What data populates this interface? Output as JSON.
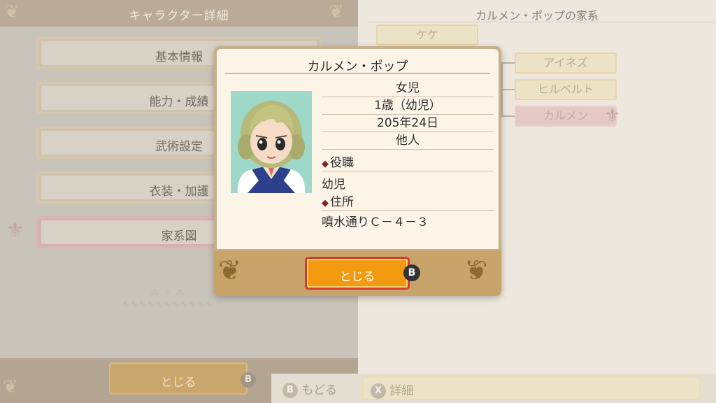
{
  "left_panel": {
    "title": "キャラクター詳細",
    "menu": [
      {
        "label": "基本情報"
      },
      {
        "label": "能力・成績"
      },
      {
        "label": "武術設定"
      },
      {
        "label": "衣装・加護"
      },
      {
        "label": "家系図"
      }
    ],
    "selected_index": 4,
    "close_button": {
      "label": "とじる",
      "hint": "B"
    }
  },
  "right_panel": {
    "title": "カルメン・ポップの家系",
    "nodes": {
      "parent": "ケケ",
      "children": [
        "アイネズ",
        "ヒルベルト",
        "カルメン"
      ]
    },
    "selected_child": "カルメン",
    "back_hint": {
      "button": "B",
      "label": "もどる"
    },
    "detail_hint": {
      "button": "X",
      "label": "詳細"
    }
  },
  "dialog": {
    "name": "カルメン・ポップ",
    "gender_age_group": "女児",
    "age": "1歳（幼児）",
    "birthday": "205年24日",
    "relation": "他人",
    "role_heading": "役職",
    "role_value": "幼児",
    "address_heading": "住所",
    "address_value": "噴水通りＣ－４－３",
    "close_button": {
      "label": "とじる",
      "hint": "B"
    }
  },
  "colors": {
    "accent_orange": "#f39b10",
    "accent_red_border": "#d23c2d",
    "diamond": "#8a1f1f"
  }
}
